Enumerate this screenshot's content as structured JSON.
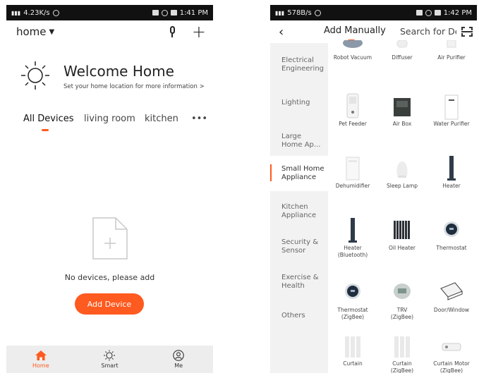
{
  "left": {
    "status": {
      "speed": "4.23K/s",
      "time": "1:41 PM"
    },
    "home_selector": "home",
    "welcome": {
      "title": "Welcome Home",
      "subtitle": "Set your home location for more information >"
    },
    "tabs": [
      "All Devices",
      "living room",
      "kitchen",
      "•••"
    ],
    "empty_text": "No devices, please add",
    "add_button": "Add Device",
    "nav": [
      {
        "label": "Home",
        "icon": "home-icon"
      },
      {
        "label": "Smart",
        "icon": "sun-icon"
      },
      {
        "label": "Me",
        "icon": "user-icon"
      }
    ],
    "accent": "#ff5a1f"
  },
  "right": {
    "status": {
      "speed": "578B/s",
      "time": "1:42 PM"
    },
    "title": "Add Manually",
    "search": "Search for De",
    "categories": [
      "Electrical\nEngineering",
      "Lighting",
      "Large\nHome Ap...",
      "Small Home\nAppliance",
      "Kitchen\nAppliance",
      "Security &\nSensor",
      "Exercise &\nHealth",
      "Others"
    ],
    "active_category": "Small Home\nAppliance",
    "devices": [
      "Robot Vacuum",
      "Diffuser",
      "Air Purifier",
      "Pet Feeder",
      "Air Box",
      "Water Purifier",
      "Dehumidifier",
      "Sleep Lamp",
      "Heater",
      "Heater\n(Bluetooth)",
      "Oil Heater",
      "Thermostat",
      "Thermostat\n(ZigBee)",
      "TRV\n(ZigBee)",
      "Door/Window",
      "Curtain",
      "Curtain\n(ZigBee)",
      "Curtain Motor\n(ZigBee)"
    ]
  }
}
